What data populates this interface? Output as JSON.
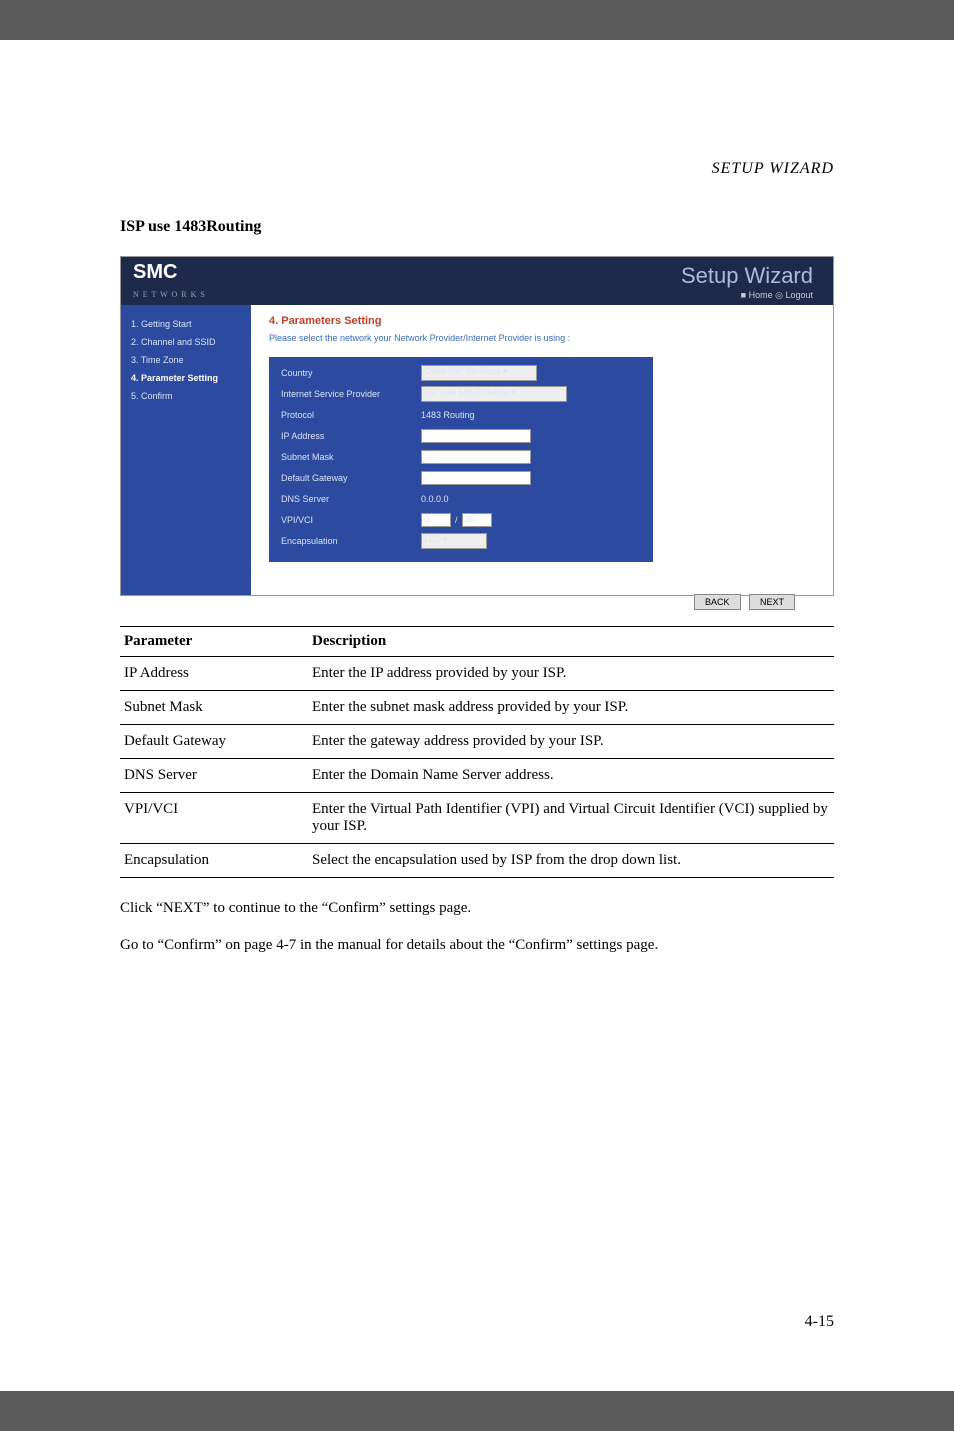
{
  "header": "SETUP WIZARD",
  "section_title": "ISP use 1483Routing",
  "screenshot": {
    "logo": "SMC",
    "logo_sub": "N E T W O R K S",
    "header_title": "Setup Wizard",
    "header_links": "■ Home  ◎ Logout",
    "sidebar": [
      "1. Getting Start",
      "2. Channel and SSID",
      "3. Time Zone",
      "4. Parameter Setting",
      "5. Confirm"
    ],
    "main_title": "4. Parameters Setting",
    "main_desc": "Please select the network your Network Provider/Internet Provider is using :",
    "form": {
      "country_label": "Country",
      "country_value": "Other ISP Services",
      "isp_label": "Internet Service Provider",
      "isp_value": "ISP use 1483Routing",
      "protocol_label": "Protocol",
      "protocol_value": "1483 Routing",
      "ip_label": "IP Address",
      "subnet_label": "Subnet Mask",
      "gateway_label": "Default Gateway",
      "dns_label": "DNS Server",
      "dns_value": "0.0.0.0",
      "vpivci_label": "VPI/VCI",
      "vpi_value": "0",
      "vci_value": "35",
      "encap_label": "Encapsulation",
      "encap_value": "LLC"
    },
    "btn_back": "BACK",
    "btn_next": "NEXT"
  },
  "table": {
    "head_param": "Parameter",
    "head_desc": "Description",
    "rows": [
      {
        "p": "IP Address",
        "d": "Enter the IP address provided by your ISP."
      },
      {
        "p": "Subnet Mask",
        "d": "Enter the subnet mask address provided by your ISP."
      },
      {
        "p": "Default Gateway",
        "d": "Enter the gateway address provided by your ISP."
      },
      {
        "p": "DNS Server",
        "d": "Enter the Domain Name Server address."
      },
      {
        "p": "VPI/VCI",
        "d": "Enter the Virtual Path Identifier (VPI) and Virtual Circuit Identifier (VCI) supplied by your ISP."
      },
      {
        "p": "Encapsulation",
        "d": "Select the encapsulation used by ISP from the drop down list."
      }
    ]
  },
  "body1": "Click “NEXT” to continue to the “Confirm” settings page.",
  "body2": "Go to “Confirm” on page 4-7 in the manual for details about the “Confirm” settings page.",
  "page_number": "4-15"
}
